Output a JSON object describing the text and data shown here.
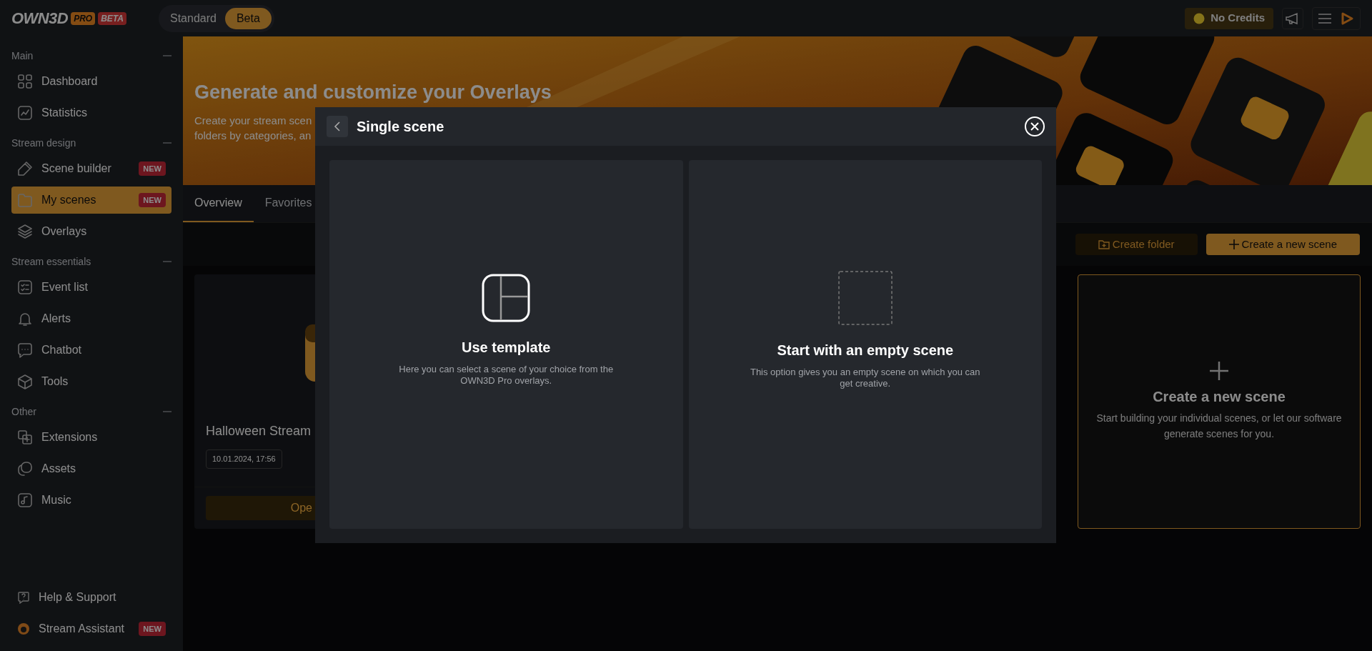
{
  "header": {
    "logo": {
      "wordmark": "OWN3D",
      "pro": "PRO",
      "beta": "BETA"
    },
    "mode_toggle": [
      {
        "label": "Standard",
        "selected": false
      },
      {
        "label": "Beta",
        "selected": true
      }
    ],
    "credits": "No Credits"
  },
  "sidebar": {
    "sections": [
      {
        "title": "Main",
        "expanded": true,
        "items": [
          {
            "label": "Dashboard",
            "selected": false
          },
          {
            "label": "Statistics",
            "selected": false
          }
        ]
      },
      {
        "title": "Stream design",
        "expanded": true,
        "items": [
          {
            "label": "Scene builder",
            "badge": "NEW",
            "selected": false
          },
          {
            "label": "My scenes",
            "badge": "NEW",
            "selected": true
          },
          {
            "label": "Overlays",
            "selected": false
          }
        ]
      },
      {
        "title": "Stream essentials",
        "expanded": true,
        "items": [
          {
            "label": "Event list",
            "selected": false
          },
          {
            "label": "Alerts",
            "selected": false
          },
          {
            "label": "Chatbot",
            "selected": false
          },
          {
            "label": "Tools",
            "selected": false
          }
        ]
      },
      {
        "title": "Other",
        "expanded": true,
        "items": [
          {
            "label": "Extensions",
            "selected": false
          },
          {
            "label": "Assets",
            "selected": false
          },
          {
            "label": "Music",
            "selected": false
          }
        ]
      }
    ],
    "footer": [
      {
        "label": "Help & Support"
      },
      {
        "label": "Stream Assistant",
        "badge": "NEW"
      }
    ]
  },
  "banner": {
    "title": "Generate and customize your Overlays",
    "subtitle_lines": [
      "Create your stream scen",
      "folders by categories, an"
    ]
  },
  "tabs": [
    {
      "label": "Overview",
      "selected": true
    },
    {
      "label": "Favorites",
      "selected": false
    }
  ],
  "toolbar": {
    "create_folder": "Create folder",
    "create_scene": "Create a new scene"
  },
  "scenes": [
    {
      "title": "Halloween Stream",
      "date": "10.01.2024, 17:56",
      "action": "Ope"
    }
  ],
  "new_scene_card": {
    "title": "Create a new scene",
    "description": "Start building your individual scenes, or let our software generate scenes for you."
  },
  "modal": {
    "title": "Single scene",
    "options": [
      {
        "kind": "template",
        "title": "Use template",
        "description": "Here you can select a scene of your choice from the OWN3D Pro overlays."
      },
      {
        "kind": "empty",
        "title": "Start with an empty scene",
        "description": "This option gives you an empty scene on which you can get creative."
      }
    ]
  }
}
